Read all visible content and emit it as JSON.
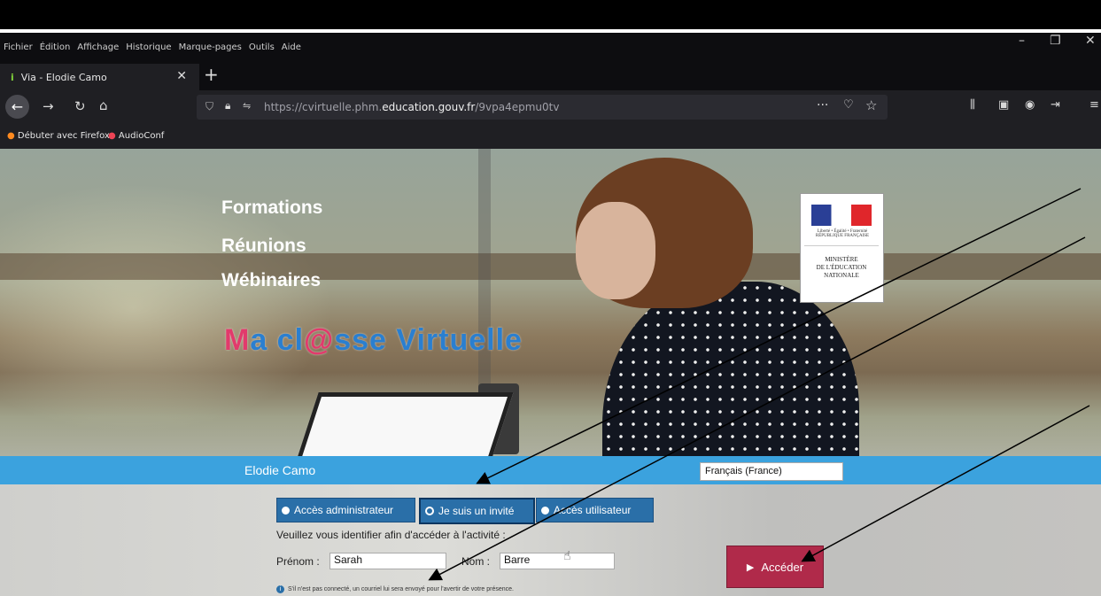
{
  "browser": {
    "menu": [
      "Fichier",
      "Édition",
      "Affichage",
      "Historique",
      "Marque-pages",
      "Outils",
      "Aide"
    ],
    "tab_title": "Via - Elodie Camo",
    "url_prefix": "https://cvirtuelle.phm.",
    "url_domain": "education.gouv.fr",
    "url_path": "/9vpa4epmu0tv",
    "bookmarks": [
      "Débuter avec Firefox",
      "AudioConf"
    ]
  },
  "hero": {
    "lines": [
      "Formations",
      "Réunions",
      "Wébinaires"
    ],
    "brand_m": "M",
    "brand_a": "a cl",
    "brand_at": "@",
    "brand_rest": "sse Virtuelle",
    "rf_text": "Liberté • Égalité • Fraternité RÉPUBLIQUE FRANÇAISE",
    "ministere_lines": [
      "MINISTÈRE",
      "DE L'ÉDUCATION",
      "NATIONALE"
    ]
  },
  "session": {
    "owner": "Elodie Camo",
    "language": "Français (France)"
  },
  "form": {
    "access_options": [
      "Accès administrateur",
      "Je suis un invité",
      "Accès utilisateur"
    ],
    "instructions": "Veuillez vous identifier afin d'accéder à l'activité :",
    "firstname_label": "Prénom :",
    "firstname_value": "Sarah",
    "lastname_label": "Nom :",
    "lastname_value": "Barre",
    "submit_label": "Accéder",
    "note": "S'il n'est pas connecté, un courriel lui sera envoyé pour l'avertir de votre présence."
  },
  "colors": {
    "blue_bar": "#3ba2de",
    "radio_blue": "#2a6fa8",
    "submit_red": "#b02a4a",
    "brand_pink": "#e23a6c",
    "brand_blue": "#2a7fd0"
  }
}
